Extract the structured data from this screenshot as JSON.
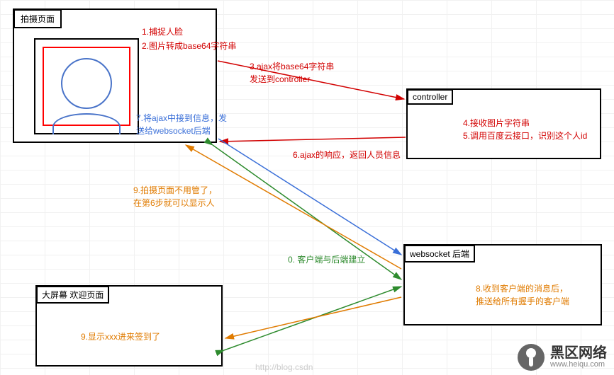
{
  "boxes": {
    "capture": {
      "title": "拍摄页面"
    },
    "controller": {
      "title": "controller"
    },
    "websocket": {
      "title": "websocket 后端"
    },
    "welcome": {
      "title": "大屏幕 欢迎页面"
    }
  },
  "steps": {
    "s0": "0. 客户端与后端建立",
    "s1": "1.捕捉人脸",
    "s2": "2.图片转成base64字符串",
    "s3a": "3.ajax将base64字符串",
    "s3b": "发送到controller",
    "s4": "4.接收图片字符串",
    "s5": "5.调用百度云接口，识别这个人id",
    "s6": "6.ajax的响应，返回人员信息",
    "s7a": "7.将ajax中接到信息，发",
    "s7b": "送给websocket后端",
    "s8a": "8.收到客户端的消息后，",
    "s8b": "推送给所有握手的客户端",
    "s9a": "9.拍摄页面不用管了，",
    "s9b": "在第6步就可以显示人",
    "s9c": "9.显示xxx进来签到了"
  },
  "watermark": {
    "name": "黑区网络",
    "url": "www.heiqu.com"
  },
  "faded": "http://blog.csdn"
}
